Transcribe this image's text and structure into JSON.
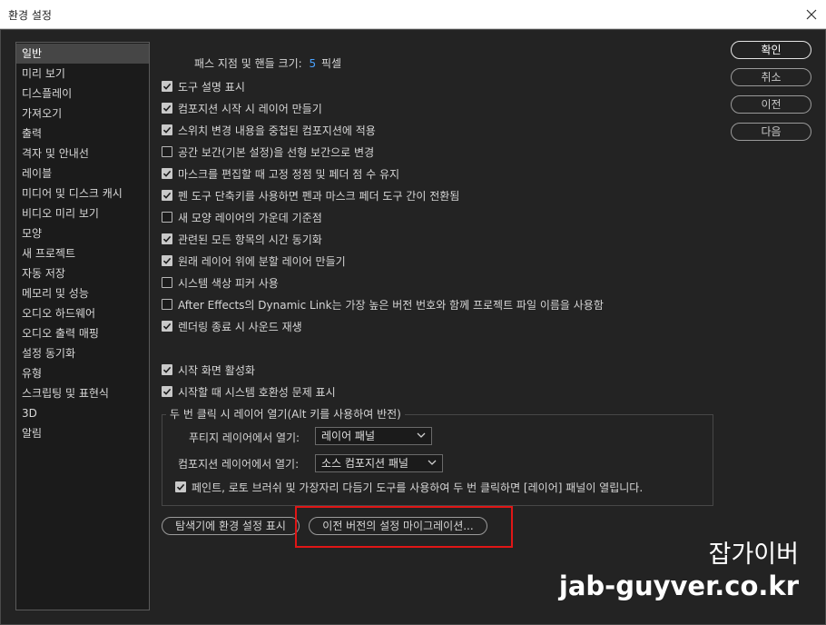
{
  "window": {
    "title": "환경 설정"
  },
  "sidebar": {
    "items": [
      {
        "label": "일반"
      },
      {
        "label": "미리 보기"
      },
      {
        "label": "디스플레이"
      },
      {
        "label": "가져오기"
      },
      {
        "label": "출력"
      },
      {
        "label": "격자 및 안내선"
      },
      {
        "label": "레이블"
      },
      {
        "label": "미디어 및 디스크 캐시"
      },
      {
        "label": "비디오 미리 보기"
      },
      {
        "label": "모양"
      },
      {
        "label": "새 프로젝트"
      },
      {
        "label": "자동 저장"
      },
      {
        "label": "메모리 및 성능"
      },
      {
        "label": "오디오 하드웨어"
      },
      {
        "label": "오디오 출력 매핑"
      },
      {
        "label": "설정 동기화"
      },
      {
        "label": "유형"
      },
      {
        "label": "스크립팅 및 표현식"
      },
      {
        "label": "3D"
      },
      {
        "label": "알림"
      }
    ],
    "selected_index": 0
  },
  "path_size": {
    "label": "패스 지점 및 핸들 크기:",
    "value": "5",
    "unit": "픽셀"
  },
  "options": [
    {
      "label": "도구 설명 표시",
      "checked": true
    },
    {
      "label": "컴포지션 시작 시 레이어 만들기",
      "checked": true
    },
    {
      "label": "스위치 변경 내용을 중첩된 컴포지션에 적용",
      "checked": true
    },
    {
      "label": "공간 보간(기본 설정)을 선형 보간으로 변경",
      "checked": false
    },
    {
      "label": "마스크를 편집할 때 고정 정점 및 페더 점 수 유지",
      "checked": true
    },
    {
      "label": "펜 도구 단축키를 사용하면 펜과 마스크 페더 도구 간이 전환됨",
      "checked": true
    },
    {
      "label": "새 모양 레이어의 가운데 기준점",
      "checked": false
    },
    {
      "label": "관련된 모든 항목의 시간 동기화",
      "checked": true
    },
    {
      "label": "원래 레이어 위에 분할 레이어 만들기",
      "checked": true
    },
    {
      "label": "시스템 색상 피커 사용",
      "checked": false
    },
    {
      "label": "After Effects의 Dynamic Link는 가장 높은 버전 번호와 함께 프로젝트 파일 이름을 사용함",
      "checked": false
    },
    {
      "label": "렌더링 종료 시 사운드 재생",
      "checked": true
    }
  ],
  "options2": [
    {
      "label": "시작 화면 활성화",
      "checked": true
    },
    {
      "label": "시작할 때 시스템 호환성 문제 표시",
      "checked": true
    }
  ],
  "double_click": {
    "legend": "두 번 클릭 시 레이어 열기(Alt 키를 사용하여 반전)",
    "footage_label": "푸티지 레이어에서 열기:",
    "footage_value": "레이어 패널",
    "comp_label": "컴포지션 레이어에서 열기:",
    "comp_value": "소스 컴포지션 패널",
    "paint_option": {
      "label": "페인트, 로토 브러쉬 및 가장자리 다듬기 도구를 사용하여 두 번 클릭하면 [레이어] 패널이 열립니다.",
      "checked": true
    }
  },
  "bottom_buttons": {
    "reveal": "탐색기에 환경 설정 표시",
    "migrate": "이전 버전의 설정 마이그레이션..."
  },
  "right_buttons": {
    "ok": "확인",
    "cancel": "취소",
    "previous": "이전",
    "next": "다음"
  },
  "watermark": {
    "line1": "잡가이버",
    "line2": "jab-guyver.co.kr"
  },
  "colors": {
    "accent": "#4ba3ff",
    "highlight": "#e01616",
    "background": "#232323"
  }
}
